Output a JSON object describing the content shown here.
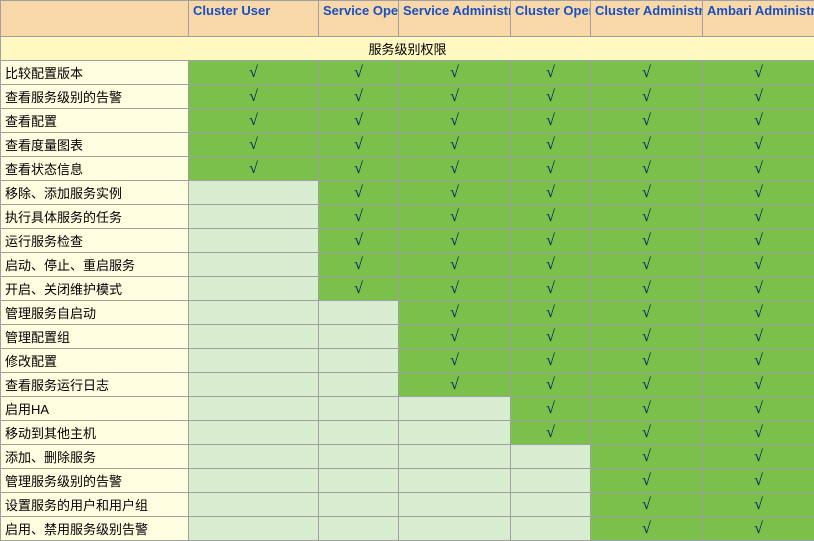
{
  "chart_data": {
    "type": "table",
    "title": "服务级别权限",
    "roles": [
      "Cluster User",
      "Service Operator",
      "Service Administrator",
      "Cluster Operator",
      "Cluster Administrator",
      "Ambari Administrator"
    ],
    "permissions": [
      {
        "label": "比较配置版本",
        "grants": [
          true,
          true,
          true,
          true,
          true,
          true
        ]
      },
      {
        "label": "查看服务级别的告警",
        "grants": [
          true,
          true,
          true,
          true,
          true,
          true
        ]
      },
      {
        "label": "查看配置",
        "grants": [
          true,
          true,
          true,
          true,
          true,
          true
        ]
      },
      {
        "label": "查看度量图表",
        "grants": [
          true,
          true,
          true,
          true,
          true,
          true
        ]
      },
      {
        "label": "查看状态信息",
        "grants": [
          true,
          true,
          true,
          true,
          true,
          true
        ]
      },
      {
        "label": "移除、添加服务实例",
        "grants": [
          false,
          true,
          true,
          true,
          true,
          true
        ]
      },
      {
        "label": "执行具体服务的任务",
        "grants": [
          false,
          true,
          true,
          true,
          true,
          true
        ]
      },
      {
        "label": "运行服务检查",
        "grants": [
          false,
          true,
          true,
          true,
          true,
          true
        ]
      },
      {
        "label": "启动、停止、重启服务",
        "grants": [
          false,
          true,
          true,
          true,
          true,
          true
        ]
      },
      {
        "label": "开启、关闭维护模式",
        "grants": [
          false,
          true,
          true,
          true,
          true,
          true
        ]
      },
      {
        "label": "管理服务自启动",
        "grants": [
          false,
          false,
          true,
          true,
          true,
          true
        ]
      },
      {
        "label": "管理配置组",
        "grants": [
          false,
          false,
          true,
          true,
          true,
          true
        ]
      },
      {
        "label": "修改配置",
        "grants": [
          false,
          false,
          true,
          true,
          true,
          true
        ]
      },
      {
        "label": "查看服务运行日志",
        "grants": [
          false,
          false,
          true,
          true,
          true,
          true
        ]
      },
      {
        "label": "启用HA",
        "grants": [
          false,
          false,
          false,
          true,
          true,
          true
        ]
      },
      {
        "label": "移动到其他主机",
        "grants": [
          false,
          false,
          false,
          true,
          true,
          true
        ]
      },
      {
        "label": "添加、删除服务",
        "grants": [
          false,
          false,
          false,
          false,
          true,
          true
        ]
      },
      {
        "label": "管理服务级别的告警",
        "grants": [
          false,
          false,
          false,
          false,
          true,
          true
        ]
      },
      {
        "label": "设置服务的用户和用户组",
        "grants": [
          false,
          false,
          false,
          false,
          true,
          true
        ]
      },
      {
        "label": "启用、禁用服务级别告警",
        "grants": [
          false,
          false,
          false,
          false,
          true,
          true
        ]
      }
    ],
    "check_glyph": "√"
  }
}
